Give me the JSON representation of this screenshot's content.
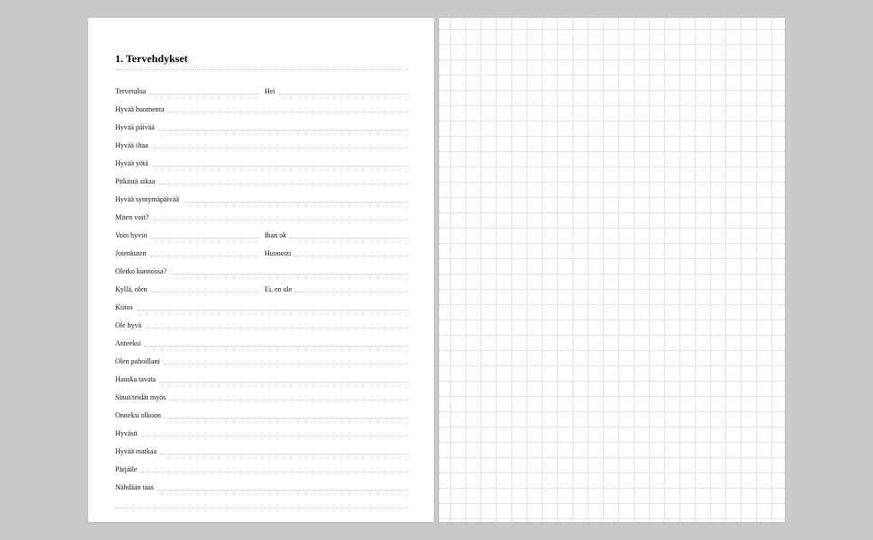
{
  "heading": "1. Tervehdykset",
  "rows": [
    {
      "cols": [
        "Tervetuloa",
        "Hei"
      ]
    },
    {
      "cols": [
        "Hyvää huomenta"
      ]
    },
    {
      "cols": [
        "Hyvää päivää"
      ]
    },
    {
      "cols": [
        "Hyvää iltaa"
      ]
    },
    {
      "cols": [
        "Hyvää yötä"
      ]
    },
    {
      "cols": [
        "Pitkästä aikaa"
      ]
    },
    {
      "cols": [
        "Hyvää syntymäpäivää"
      ]
    },
    {
      "cols": [
        "Miten voit?"
      ]
    },
    {
      "cols": [
        "Voin hyvin",
        "Ihan ok"
      ]
    },
    {
      "cols": [
        "Jotenkuten",
        "Huonosti"
      ]
    },
    {
      "cols": [
        "Oletko kunnossa?"
      ]
    },
    {
      "cols": [
        "Kyllä, olen",
        "Ei, en ole"
      ]
    },
    {
      "cols": [
        "Kiitos"
      ]
    },
    {
      "cols": [
        "Ole hyvä"
      ]
    },
    {
      "cols": [
        "Anteeksi"
      ]
    },
    {
      "cols": [
        "Olen pahoillani"
      ]
    },
    {
      "cols": [
        "Hauska tavata"
      ]
    },
    {
      "cols": [
        "Sinut/teidät myös"
      ]
    },
    {
      "cols": [
        "Onneksi olkoon"
      ]
    },
    {
      "cols": [
        "Hyvästi"
      ]
    },
    {
      "cols": [
        "Hyvää matkaa"
      ]
    },
    {
      "cols": [
        "Pärjäile"
      ]
    },
    {
      "cols": [
        "Nähdään taas"
      ]
    },
    {
      "cols": [
        ""
      ]
    }
  ]
}
